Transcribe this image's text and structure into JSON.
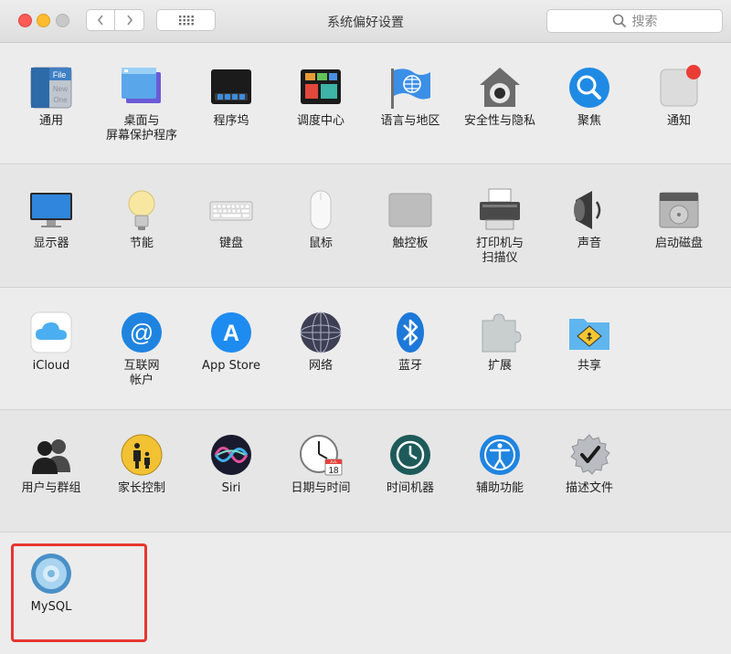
{
  "window": {
    "title": "系统偏好设置",
    "search_placeholder": "搜索"
  },
  "rows": [
    [
      {
        "label": "通用",
        "icon": "general-icon"
      },
      {
        "label": "桌面与\n屏幕保护程序",
        "icon": "desktop-screensaver-icon"
      },
      {
        "label": "程序坞",
        "icon": "dock-icon"
      },
      {
        "label": "调度中心",
        "icon": "mission-control-icon"
      },
      {
        "label": "语言与地区",
        "icon": "language-region-icon"
      },
      {
        "label": "安全性与隐私",
        "icon": "security-privacy-icon"
      },
      {
        "label": "聚焦",
        "icon": "spotlight-icon"
      },
      {
        "label": "通知",
        "icon": "notifications-icon"
      }
    ],
    [
      {
        "label": "显示器",
        "icon": "displays-icon"
      },
      {
        "label": "节能",
        "icon": "energy-saver-icon"
      },
      {
        "label": "键盘",
        "icon": "keyboard-icon"
      },
      {
        "label": "鼠标",
        "icon": "mouse-icon"
      },
      {
        "label": "触控板",
        "icon": "trackpad-icon"
      },
      {
        "label": "打印机与\n扫描仪",
        "icon": "printers-scanners-icon"
      },
      {
        "label": "声音",
        "icon": "sound-icon"
      },
      {
        "label": "启动磁盘",
        "icon": "startup-disk-icon"
      }
    ],
    [
      {
        "label": "iCloud",
        "icon": "icloud-icon"
      },
      {
        "label": "互联网\n帐户",
        "icon": "internet-accounts-icon"
      },
      {
        "label": "App Store",
        "icon": "app-store-icon"
      },
      {
        "label": "网络",
        "icon": "network-icon"
      },
      {
        "label": "蓝牙",
        "icon": "bluetooth-icon"
      },
      {
        "label": "扩展",
        "icon": "extensions-icon"
      },
      {
        "label": "共享",
        "icon": "sharing-icon"
      }
    ],
    [
      {
        "label": "用户与群组",
        "icon": "users-groups-icon"
      },
      {
        "label": "家长控制",
        "icon": "parental-controls-icon"
      },
      {
        "label": "Siri",
        "icon": "siri-icon"
      },
      {
        "label": "日期与时间",
        "icon": "date-time-icon"
      },
      {
        "label": "时间机器",
        "icon": "time-machine-icon"
      },
      {
        "label": "辅助功能",
        "icon": "accessibility-icon"
      },
      {
        "label": "描述文件",
        "icon": "profiles-icon"
      }
    ],
    [
      {
        "label": "MySQL",
        "icon": "mysql-icon"
      }
    ]
  ],
  "calendar_badge": {
    "month": "JUL",
    "day": "18"
  },
  "app_store_glyph": "A",
  "internet_accounts_glyph": "@",
  "general_icon_text": [
    "File",
    "New",
    "One"
  ],
  "colors": {
    "highlight_border": "#e6362f",
    "close": "#fd5b55",
    "minimize": "#fdbb2f",
    "maximize": "#c8c8c8"
  }
}
